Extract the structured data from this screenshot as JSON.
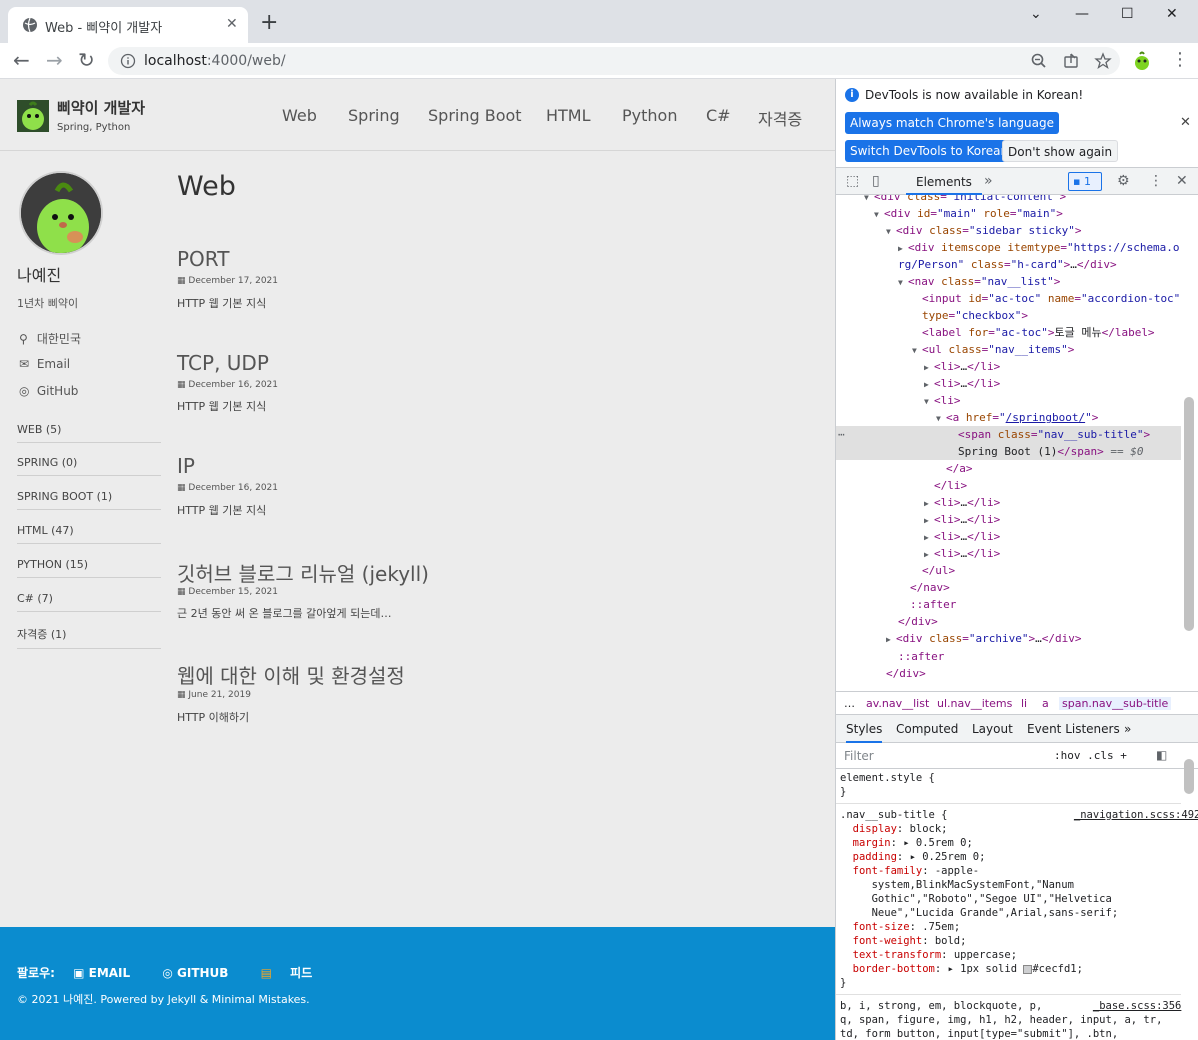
{
  "browser": {
    "tab_title": "Web - 삐약이 개발자",
    "tab_close": "✕",
    "new_tab": "+",
    "window_controls": [
      "⌄",
      "—",
      "☐",
      "✕"
    ],
    "url_host": "localhost",
    "url_rest": ":4000/web/"
  },
  "site": {
    "title": "삐약이 개발자",
    "subtitle": "Spring, Python",
    "nav": [
      "Web",
      "Spring",
      "Spring Boot",
      "HTML",
      "Python",
      "C#",
      "자격증"
    ]
  },
  "author": {
    "name": "나예진",
    "bio": "1년차 삐약이",
    "links": [
      {
        "icon": "location-icon",
        "glyph": "⚲",
        "label": "대한민국"
      },
      {
        "icon": "email-icon",
        "glyph": "✉",
        "label": "Email"
      },
      {
        "icon": "github-icon",
        "glyph": "◎",
        "label": "GitHub"
      }
    ]
  },
  "categories": [
    "WEB (5)",
    "SPRING (0)",
    "SPRING BOOT (1)",
    "HTML (47)",
    "PYTHON (15)",
    "C# (7)",
    "자격증 (1)"
  ],
  "archive": {
    "title": "Web",
    "posts": [
      {
        "title": "PORT",
        "date": "December 17, 2021",
        "excerpt": "HTTP 웹 기본 지식"
      },
      {
        "title": "TCP, UDP",
        "date": "December 16, 2021",
        "excerpt": "HTTP 웹 기본 지식"
      },
      {
        "title": "IP",
        "date": "December 16, 2021",
        "excerpt": "HTTP 웹 기본 지식"
      },
      {
        "title": "깃허브 블로그 리뉴얼 (jekyll)",
        "date": "December 15, 2021",
        "excerpt": "근 2년 동안 써 온 블로그를 갈아엎게 되는데…"
      },
      {
        "title": "웹에 대한 이해 및 환경설정",
        "date": "June 21, 2019",
        "excerpt": "HTTP 이해하기"
      }
    ]
  },
  "footer": {
    "follow_label": "팔로우:",
    "follow_links": [
      "EMAIL",
      "GITHUB",
      "피드"
    ],
    "copyright": "© 2021 나예진. Powered by Jekyll & Minimal Mistakes."
  },
  "devtools": {
    "info_text": "DevTools is now available in Korean!",
    "btn_match": "Always match Chrome's language",
    "btn_switch": "Switch DevTools to Korean",
    "btn_dont_show": "Don't show again",
    "tab_elements": "Elements",
    "issues_count": "1",
    "breadcrumbs": [
      "…",
      "av.nav__list",
      "ul.nav__items",
      "li",
      "a",
      "span.nav__sub-title"
    ],
    "styles_tabs": [
      "Styles",
      "Computed",
      "Layout",
      "Event Listeners",
      "»"
    ],
    "filter_placeholder": "Filter",
    "filter_tools": ":hov  .cls  +",
    "colors": {
      "accent": "#1a73e8",
      "footer_bg": "#0b8ccf"
    }
  }
}
